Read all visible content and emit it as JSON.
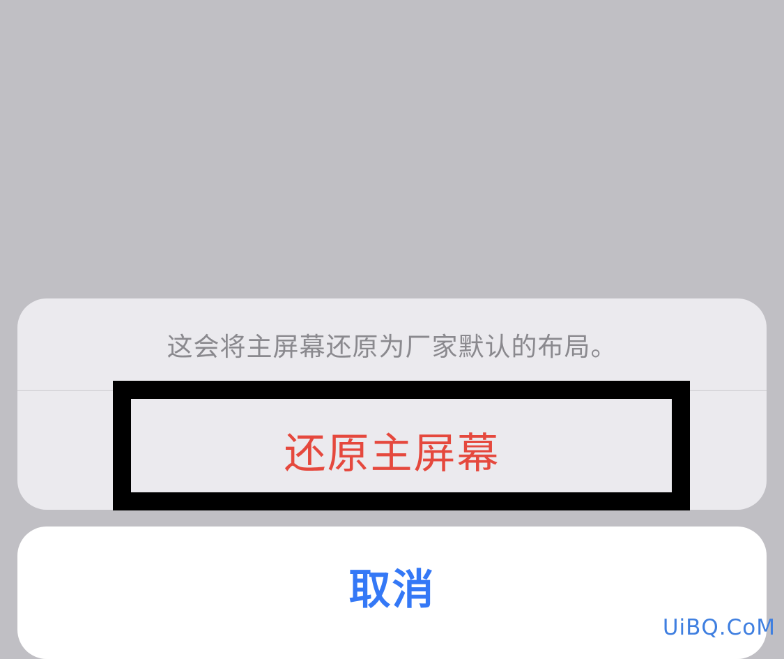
{
  "action_sheet": {
    "message": "这会将主屏幕还原为厂家默认的布局。",
    "reset_label": "还原主屏幕",
    "cancel_label": "取消"
  },
  "watermark": "UiBQ.CoM",
  "colors": {
    "background": "#c0bfc4",
    "sheet_background": "#ebeaee",
    "destructive": "#e5483d",
    "cancel": "#3478f6",
    "message_text": "#8a898e",
    "annotation_box": "#000000",
    "watermark": "#3f7fe0"
  }
}
